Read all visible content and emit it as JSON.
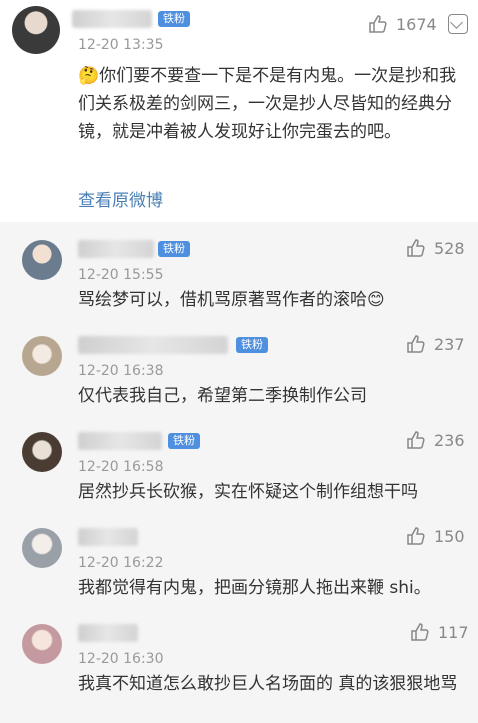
{
  "main_comment": {
    "time": "12-20 13:35",
    "likes": "1674",
    "text": "你们要不要查一下是不是有内鬼。一次是抄和我们关系极差的剑网三，一次是抄人尽皆知的经典分镜，就是冲着被人发现好让你完蛋去的吧。",
    "emoji": "🤔",
    "view_original": "查看原微博"
  },
  "replies": [
    {
      "badge": "铁粉",
      "time": "12-20 15:55",
      "likes": "528",
      "text": "骂绘梦可以，借机骂原著骂作者的滚哈😊"
    },
    {
      "badge": "铁粉",
      "time": "12-20 16:38",
      "likes": "237",
      "text": "仅代表我自己，希望第二季换制作公司"
    },
    {
      "badge": "铁粉",
      "time": "12-20 16:58",
      "likes": "236",
      "text": "居然抄兵长砍猴，实在怀疑这个制作组想干吗"
    },
    {
      "badge": "",
      "time": "12-20 16:22",
      "likes": "150",
      "text": "我都觉得有内鬼，把画分镜那人拖出来鞭 shi。"
    },
    {
      "badge": "",
      "time": "12-20 16:30",
      "likes": "117",
      "text": "我真不知道怎么敢抄巨人名场面的 真的该狠狠地骂"
    }
  ],
  "colors": {
    "badge": "#4e8fe0",
    "link": "#4a7fb5",
    "reply_bg": "#f5f5f5"
  }
}
